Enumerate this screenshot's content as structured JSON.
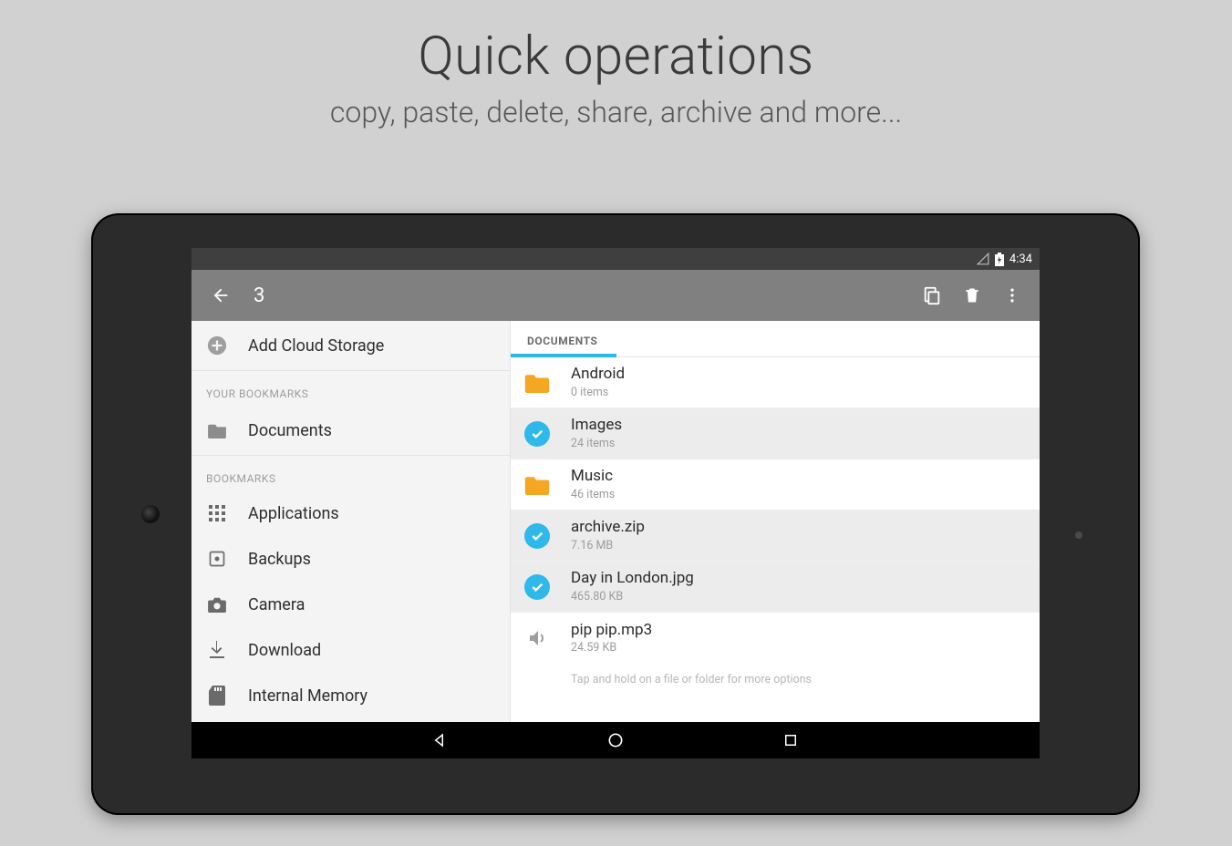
{
  "hero": {
    "title": "Quick operations",
    "subtitle": "copy, paste, delete, share, archive and more..."
  },
  "statusbar": {
    "time": "4:34"
  },
  "appbar": {
    "selection_count": "3"
  },
  "sidebar": {
    "add_cloud": "Add Cloud Storage",
    "your_bookmarks_header": "YOUR BOOKMARKS",
    "documents": "Documents",
    "bookmarks_header": "BOOKMARKS",
    "items": [
      {
        "label": "Applications"
      },
      {
        "label": "Backups"
      },
      {
        "label": "Camera"
      },
      {
        "label": "Download"
      },
      {
        "label": "Internal Memory"
      }
    ]
  },
  "content": {
    "tab_label": "DOCUMENTS",
    "files": [
      {
        "name": "Android",
        "meta": "0 items"
      },
      {
        "name": "Images",
        "meta": "24 items"
      },
      {
        "name": "Music",
        "meta": "46 items"
      },
      {
        "name": "archive.zip",
        "meta": "7.16 MB"
      },
      {
        "name": "Day in London.jpg",
        "meta": "465.80 KB"
      },
      {
        "name": "pip pip.mp3",
        "meta": "24.59 KB"
      }
    ],
    "hint": "Tap and hold on a file or folder for more options"
  }
}
